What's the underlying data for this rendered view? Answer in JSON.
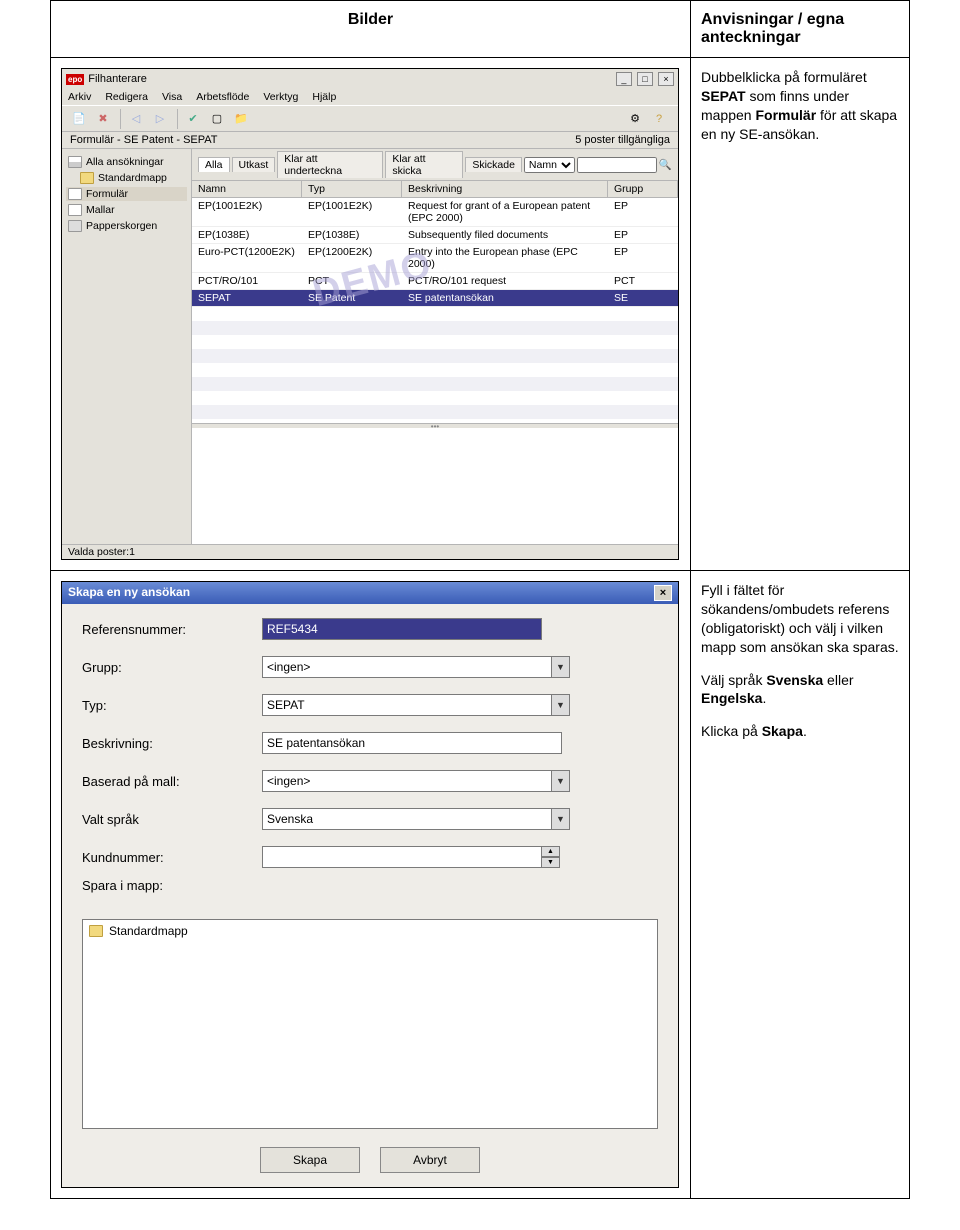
{
  "headers": {
    "left": "Bilder",
    "right": "Anvisningar / egna anteckningar"
  },
  "instr1": {
    "p1a": "Dubbelklicka på formuläret ",
    "p1b": "SEPAT",
    "p1c": " som finns under mappen ",
    "p1d": "Formulär",
    "p1e": " för att skapa en ny SE-ansökan."
  },
  "instr2": {
    "p1": "Fyll i fältet för sökandens/ombudets referens (obligatoriskt) och välj i vilken mapp som ansökan ska sparas.",
    "p2a": "Välj språk ",
    "p2b": "Svenska",
    "p2c": " eller ",
    "p2d": "Engelska",
    "p2e": ".",
    "p3a": "Klicka på ",
    "p3b": "Skapa",
    "p3c": "."
  },
  "fm": {
    "logo": "epo",
    "title": "Filhanterare",
    "menus": [
      "Arkiv",
      "Redigera",
      "Visa",
      "Arbetsflöde",
      "Verktyg",
      "Hjälp"
    ],
    "pathline": "Formulär  - SE Patent - SEPAT",
    "count": "5 poster tillgängliga",
    "tree": [
      "Alla ansökningar",
      "Standardmapp",
      "Formulär",
      "Mallar",
      "Papperskorgen"
    ],
    "tabs": [
      "Alla",
      "Utkast",
      "Klar att underteckna",
      "Klar att skicka",
      "Skickade"
    ],
    "filter_label": "Namn",
    "columns": [
      "Namn",
      "Typ",
      "Beskrivning",
      "Grupp"
    ],
    "rows": [
      {
        "namn": "EP(1001E2K)",
        "typ": "EP(1001E2K)",
        "besk": "Request for grant of a European patent (EPC 2000)",
        "grupp": "EP"
      },
      {
        "namn": "EP(1038E)",
        "typ": "EP(1038E)",
        "besk": "Subsequently filed documents",
        "grupp": "EP"
      },
      {
        "namn": "Euro-PCT(1200E2K)",
        "typ": "EP(1200E2K)",
        "besk": "Entry into the European phase (EPC 2000)",
        "grupp": "EP"
      },
      {
        "namn": "PCT/RO/101",
        "typ": "PCT",
        "besk": "PCT/RO/101 request",
        "grupp": "PCT"
      },
      {
        "namn": "SEPAT",
        "typ": "SE Patent",
        "besk": "SE patentansökan",
        "grupp": "SE"
      }
    ],
    "demo": "DEMO",
    "status": "Valda poster:1"
  },
  "dlg": {
    "title": "Skapa en ny ansökan",
    "labels": {
      "ref": "Referensnummer:",
      "grupp": "Grupp:",
      "typ": "Typ:",
      "besk": "Beskrivning:",
      "mall": "Baserad på mall:",
      "sprak": "Valt språk",
      "kund": "Kundnummer:",
      "spara": "Spara i mapp:"
    },
    "values": {
      "ref": "REF5434",
      "grupp": "<ingen>",
      "typ": "SEPAT",
      "besk": "SE patentansökan",
      "mall": "<ingen>",
      "sprak": "Svenska",
      "kund": ""
    },
    "folder": "Standardmapp",
    "skapa": "Skapa",
    "avbryt": "Avbryt"
  }
}
